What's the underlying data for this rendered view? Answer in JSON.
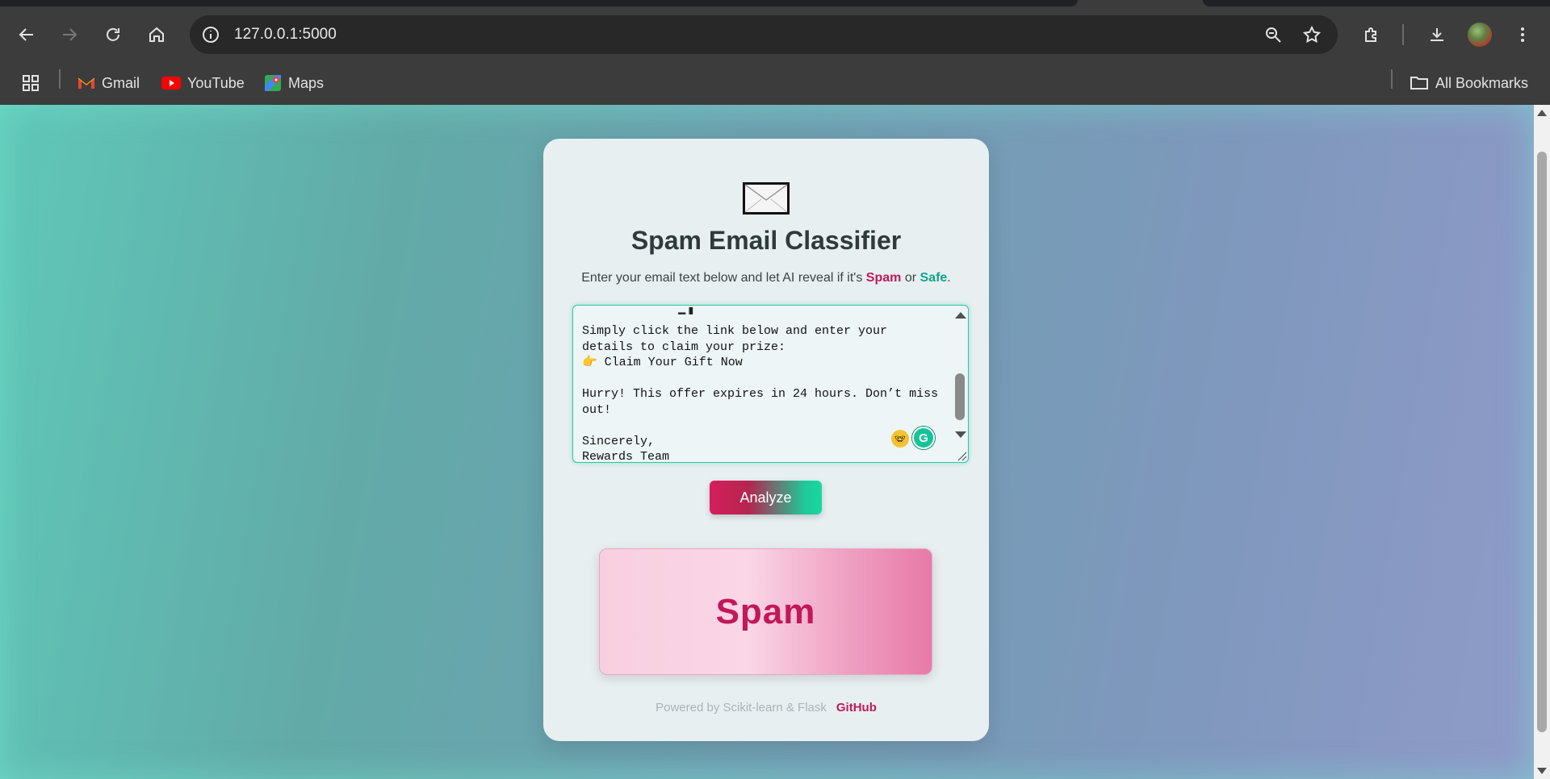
{
  "browser": {
    "url": "127.0.0.1:5000",
    "bookmarks": [
      {
        "label": "Gmail",
        "icon": "gmail-icon"
      },
      {
        "label": "YouTube",
        "icon": "youtube-icon"
      },
      {
        "label": "Maps",
        "icon": "maps-icon"
      }
    ],
    "all_bookmarks_label": "All Bookmarks"
  },
  "app": {
    "icon": "envelope-icon",
    "title": "Spam Email Classifier",
    "subtitle_prefix": "Enter your email text below and let AI reveal if it's ",
    "subtitle_spam": "Spam",
    "subtitle_or": " or ",
    "subtitle_safe": "Safe",
    "subtitle_end": ".",
    "email_text": "Simply click the link below and enter your details to claim your prize:\n👉 Claim Your Gift Now\n\nHurry! This offer expires in 24 hours. Don’t miss out!\n\nSincerely,\nRewards Team",
    "analyze_label": "Analyze",
    "result_label": "Spam",
    "footer_text": "Powered by Scikit-learn & Flask",
    "footer_link": "GitHub",
    "colors": {
      "spam": "#c2185b",
      "safe": "#12a58a",
      "accent_border": "#2ec7a5"
    }
  }
}
